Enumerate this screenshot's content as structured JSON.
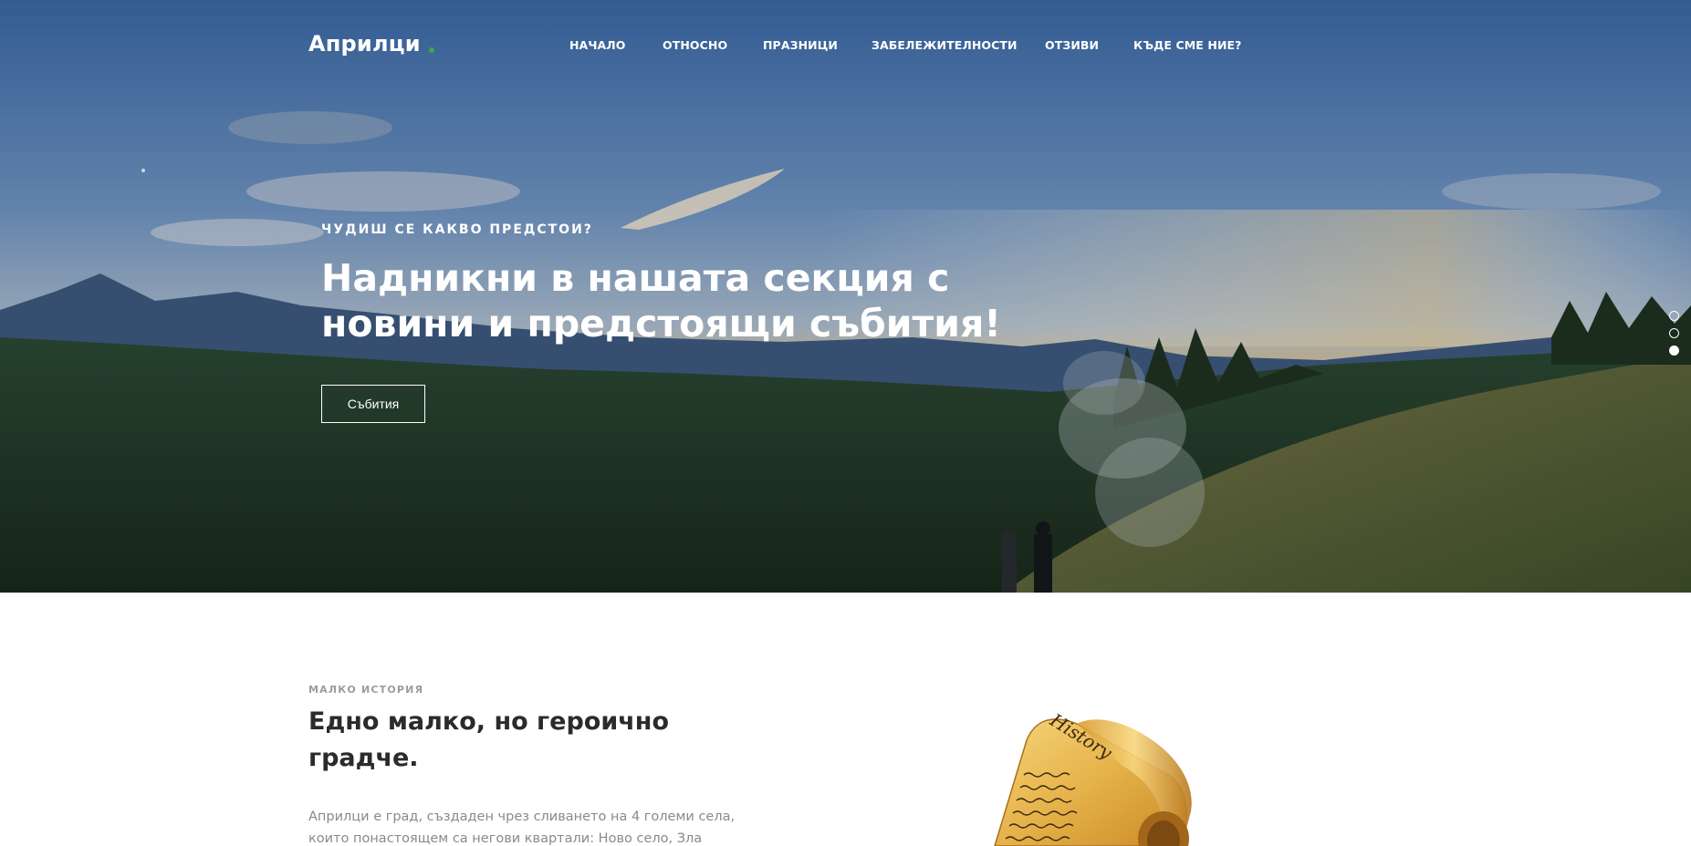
{
  "brand": {
    "name": "Априлци"
  },
  "nav": {
    "items": [
      "НАЧАЛО",
      "ОТНОСНО",
      "ПРАЗНИЦИ",
      "ЗАБЕЛЕЖИТЕЛНОСТИ",
      "ОТЗИВИ",
      "КЪДЕ СМЕ НИЕ?"
    ]
  },
  "hero": {
    "eyebrow": "ЧУДИШ СЕ КАКВО ПРЕДСТОИ?",
    "headline": "Надникни в нашата секция с новини и предстоящи събития!",
    "cta_label": "Събития",
    "slider": {
      "count": 3,
      "active_index": 2
    }
  },
  "history": {
    "label": "МАЛКО ИСТОРИЯ",
    "title": "Едно малко, но героично градче.",
    "text": "Априлци е град, създаден чрез сливането на 4 големи села, които понастоящем са негови квартали: Ново село, Зла река,",
    "image_caption": "History"
  },
  "colors": {
    "accent_dot": "#3aa84a",
    "heading": "#2b2b2b",
    "muted": "#9c9c9c"
  }
}
